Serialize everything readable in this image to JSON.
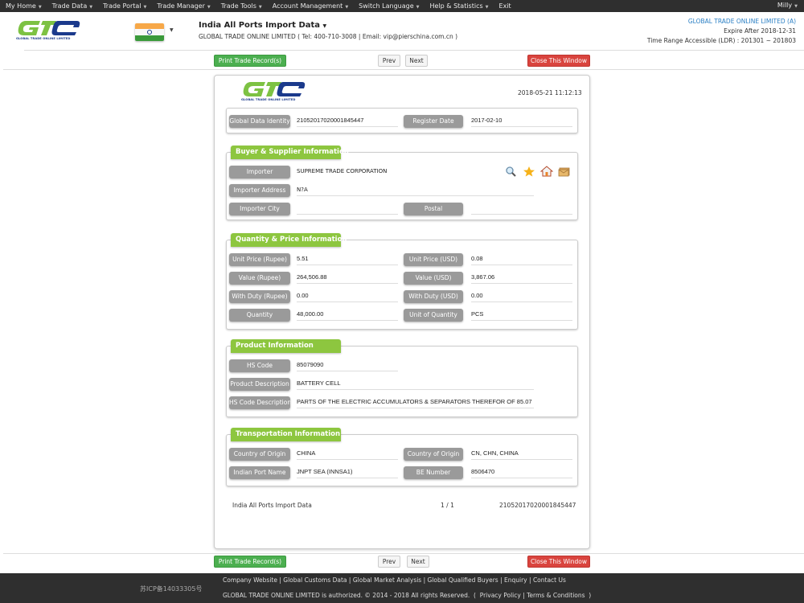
{
  "nav": {
    "items": [
      {
        "label": "My Home",
        "caret": true
      },
      {
        "label": "Trade Data",
        "caret": true
      },
      {
        "label": "Trade Portal",
        "caret": true
      },
      {
        "label": "Trade Manager",
        "caret": true
      },
      {
        "label": "Trade Tools",
        "caret": true
      },
      {
        "label": "Account Management",
        "caret": true
      },
      {
        "label": "Switch Language",
        "caret": true
      },
      {
        "label": "Help & Statistics",
        "caret": true
      },
      {
        "label": "Exit",
        "caret": false
      }
    ],
    "user": "Milly"
  },
  "header": {
    "logo_text": "GTC",
    "logo_tagline": "GLOBAL TRADE ONLINE LIMITED",
    "title": "India All Ports Import Data",
    "subtitle": "GLOBAL TRADE ONLINE LIMITED ( Tel: 400-710-3008 | Email: vip@pierschina.com.cn )",
    "account_company": "GLOBAL TRADE ONLINE LIMITED (A)",
    "expire": "Expire After 2018-12-31",
    "time_range": "Time Range Accessible (LDR) : 201301 ~ 201803",
    "colors": {
      "accent_green": "#8dc63f",
      "brand_blue": "#1b3a8c",
      "link_blue": "#2a7fc4"
    }
  },
  "toolbar": {
    "print_label": "Print Trade Record(s)",
    "prev_label": "Prev",
    "next_label": "Next",
    "close_label": "Close This Window"
  },
  "record": {
    "timestamp": "2018-05-21 11:12:13",
    "identity": {
      "global_data_identity_label": "Global Data Identity",
      "global_data_identity": "21052017020001845447",
      "register_date_label": "Register Date",
      "register_date": "2017-02-10"
    },
    "buyer": {
      "title": "Buyer & Supplier Information",
      "importer_label": "Importer",
      "importer": "SUPREME TRADE CORPORATION",
      "address_label": "Importer Address",
      "address": "N?A",
      "city_label": "Importer City",
      "city": "",
      "postal_label": "Postal",
      "postal": "",
      "icons": [
        "search-icon",
        "star-icon",
        "home-icon",
        "mail-folder-icon"
      ]
    },
    "quantity": {
      "title": "Quantity & Price Information",
      "rows": [
        {
          "l_label": "Unit Price (Rupee)",
          "l_value": "5.51",
          "r_label": "Unit Price (USD)",
          "r_value": "0.08"
        },
        {
          "l_label": "Value (Rupee)",
          "l_value": "264,506.88",
          "r_label": "Value (USD)",
          "r_value": "3,867.06"
        },
        {
          "l_label": "With Duty (Rupee)",
          "l_value": "0.00",
          "r_label": "With Duty (USD)",
          "r_value": "0.00"
        },
        {
          "l_label": "Quantity",
          "l_value": "48,000.00",
          "r_label": "Unit of Quantity",
          "r_value": "PCS"
        }
      ]
    },
    "product": {
      "title": "Product Information",
      "hs_code_label": "HS Code",
      "hs_code": "85079090",
      "desc_label": "Product Description",
      "desc": "BATTERY CELL",
      "hs_desc_label": "HS Code Description",
      "hs_desc": "PARTS OF THE ELECTRIC ACCUMULATORS & SEPARATORS THEREFOR OF 85.07"
    },
    "transport": {
      "title": "Transportation Information",
      "origin_label": "Country of Origin",
      "origin": "CHINA",
      "origin2_label": "Country of Origin",
      "origin2": "CN, CHN, CHINA",
      "port_label": "Indian Port Name",
      "port": "JNPT SEA (INNSA1)",
      "be_label": "BE Number",
      "be": "8506470"
    },
    "footer_info": {
      "source": "India All Ports Import Data",
      "page": "1 / 1",
      "id": "21052017020001845447"
    }
  },
  "footer": {
    "icp": "苏ICP备14033305号",
    "links": [
      "Company Website",
      "Global Customs Data",
      "Global Market Analysis",
      "Global Qualified Buyers",
      "Enquiry",
      "Contact Us"
    ],
    "copyright": "GLOBAL TRADE ONLINE LIMITED is authorized. © 2014 - 2018 All rights Reserved.",
    "privacy": "Privacy Policy",
    "terms": "Terms & Conditions"
  }
}
